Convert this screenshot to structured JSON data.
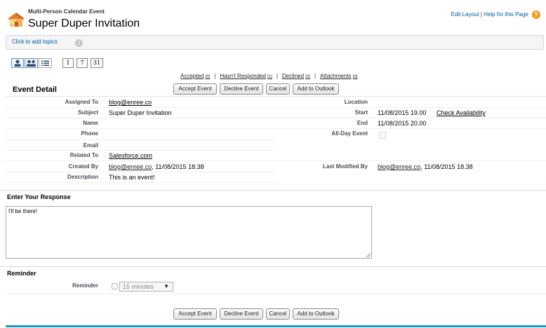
{
  "header": {
    "object_type": "Multi-Person Calendar Event",
    "title": "Super Duper Invitation",
    "edit_layout": "Edit Layout",
    "separator": "|",
    "help": "Help for this Page",
    "icon": "calendar-house-icon"
  },
  "topics": {
    "link": "Click to add topics",
    "info_icon": "i"
  },
  "view_toolbar": {
    "views": [
      {
        "icon": "single-user-view-icon"
      },
      {
        "icon": "multi-user-view-icon"
      },
      {
        "icon": "list-view-icon"
      }
    ],
    "calendar_buttons": [
      "1",
      "7",
      "31"
    ]
  },
  "related_links": [
    {
      "label": "Accepted",
      "count": "[0]"
    },
    {
      "label": "Hasn't Responded",
      "count": "[1]"
    },
    {
      "label": "Declined",
      "count": "[0]"
    },
    {
      "label": "Attachments",
      "count": "[0]"
    }
  ],
  "buttons": {
    "accept": "Accept Event",
    "decline": "Decline Event",
    "cancel": "Cancel",
    "outlook": "Add to Outlook"
  },
  "detail": {
    "section_title": "Event Detail",
    "left_fields": [
      {
        "label": "Assigned To",
        "value": "blog@enree.co"
      },
      {
        "label": "Subject",
        "value": "Super Duper Invitation"
      },
      {
        "label": "Name",
        "value": ""
      },
      {
        "label": "Phone",
        "value": ""
      },
      {
        "label": "Email",
        "value": ""
      },
      {
        "label": "Related To",
        "value": "Salesforce.com"
      },
      {
        "label": "Created By",
        "value": "blog@enree.co",
        "suffix": ", 11/08/2015 18.38"
      },
      {
        "label": "Description",
        "value": "This is an event!"
      }
    ],
    "right_fields": {
      "location": {
        "label": "Location",
        "value": ""
      },
      "start": {
        "label": "Start",
        "value": "11/08/2015 19.00",
        "action": "Check Availability"
      },
      "end": {
        "label": "End",
        "value": "11/08/2015 20.00"
      },
      "all_day": {
        "label": "All-Day Event",
        "checked": false
      },
      "last_modified": {
        "label": "Last Modified By",
        "value": "blog@enree.co",
        "suffix": ", 11/08/2015 18.38"
      }
    }
  },
  "response": {
    "title": "Enter Your Response",
    "value": "I'll be there!"
  },
  "reminder": {
    "title": "Reminder",
    "label": "Reminder",
    "checked": false,
    "selected": "15 minutes",
    "arrow": "▼"
  },
  "colors": {
    "link": "#015ba7",
    "footer_bar": "#1f97c7",
    "help_icon": "#f39a1b"
  }
}
